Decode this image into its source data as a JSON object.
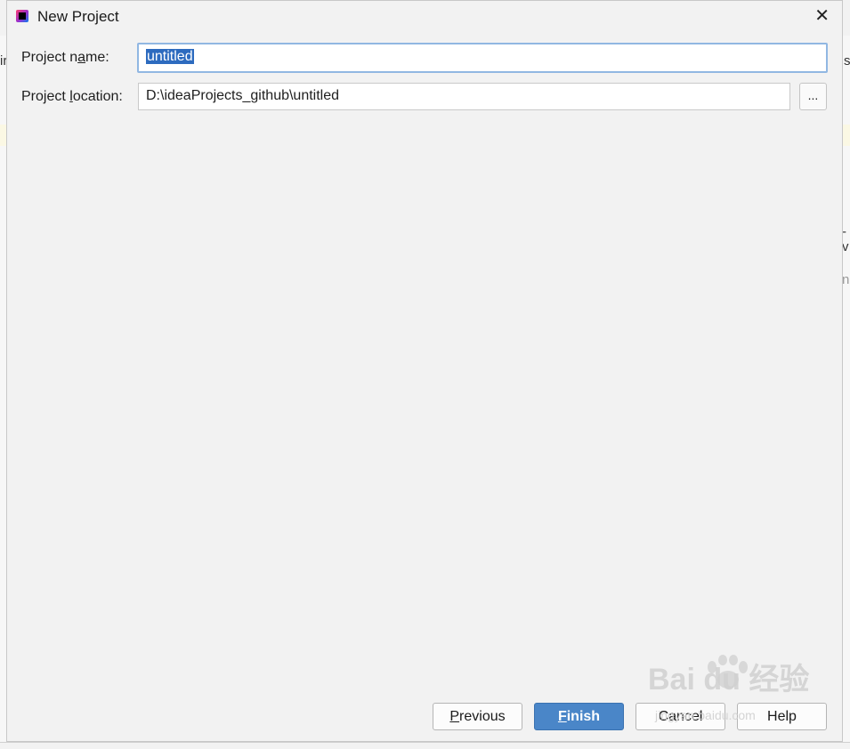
{
  "dialog": {
    "title": "New Project",
    "close_glyph": "✕"
  },
  "form": {
    "name_label_pre": "Project n",
    "name_label_u": "a",
    "name_label_post": "me:",
    "name_value": "untitled",
    "location_label_pre": "Project ",
    "location_label_u": "l",
    "location_label_post": "ocation:",
    "location_value": "D:\\ideaProjects_github\\untitled",
    "browse_label": "..."
  },
  "buttons": {
    "previous_u": "P",
    "previous_rest": "revious",
    "finish_u": "F",
    "finish_rest": "inish",
    "cancel": "Cancel",
    "help": "Help"
  },
  "background": {
    "frag_left": "ir",
    "frag_right_top": "s",
    "frag_right_mid": "-v",
    "frag_right_low": "ng"
  },
  "watermark": {
    "brand": "Bai du 经验",
    "url": "jingyan.baidu.com"
  },
  "colors": {
    "accent": "#4a86c8",
    "selection": "#2d6bbf",
    "focus_border": "#91b7e2"
  }
}
